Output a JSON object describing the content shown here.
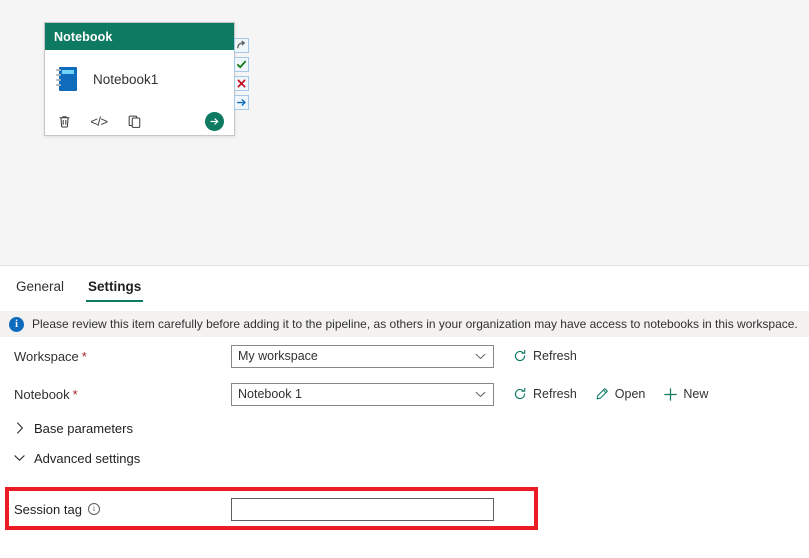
{
  "canvas": {
    "activity_card": {
      "header_title": "Notebook",
      "item_name": "Notebook1",
      "icon": "notebook-icon",
      "footer_actions": [
        {
          "name": "delete-icon",
          "glyph": "Ὕ1"
        },
        {
          "name": "code-icon",
          "glyph": "</>"
        },
        {
          "name": "duplicate-icon",
          "glyph": "copy"
        }
      ],
      "run_button": {
        "name": "run-icon",
        "glyph": "→",
        "color": "#0f7a62"
      },
      "header_color": "#0f7a62"
    },
    "connectors": [
      {
        "name": "on-skip-handle",
        "glyph": "↷",
        "color": "#605e5c"
      },
      {
        "name": "on-success-handle",
        "glyph": "✓",
        "color": "#107c10"
      },
      {
        "name": "on-failure-handle",
        "glyph": "✕",
        "color": "#c50f1f"
      },
      {
        "name": "on-completion-handle",
        "glyph": "→",
        "color": "#0f6cbd"
      }
    ]
  },
  "tabs": [
    {
      "label": "General",
      "active": false
    },
    {
      "label": "Settings",
      "active": true
    }
  ],
  "banner": {
    "icon": "info-icon",
    "icon_glyph": "i",
    "text": "Please review this item carefully before adding it to the pipeline, as others in your organization may have access to notebooks in this workspace.",
    "background": "#f3f2f1",
    "icon_color": "#0f6cbd"
  },
  "form": {
    "workspace": {
      "label": "Workspace",
      "required_marker": "*",
      "value": "My workspace",
      "chevron": "⌄",
      "actions": [
        {
          "label": "Refresh",
          "icon": "refresh-icon"
        }
      ]
    },
    "notebook": {
      "label": "Notebook",
      "required_marker": "*",
      "value": "Notebook 1",
      "chevron": "⌄",
      "actions": [
        {
          "label": "Refresh",
          "icon": "refresh-icon"
        },
        {
          "label": "Open",
          "icon": "pencil-icon"
        },
        {
          "label": "New",
          "icon": "plus-icon"
        }
      ]
    },
    "base_parameters": {
      "label": "Base parameters",
      "expanded": false,
      "twisty": "›"
    },
    "advanced_settings": {
      "label": "Advanced settings",
      "expanded": true,
      "twisty": "⌄"
    },
    "session_tag": {
      "label": "Session tag",
      "info_icon": "info-circle-icon",
      "info_glyph": "i",
      "value": "",
      "placeholder": ""
    }
  },
  "highlight": {
    "name": "session-tag-highlight",
    "color": "#ed1c24"
  }
}
